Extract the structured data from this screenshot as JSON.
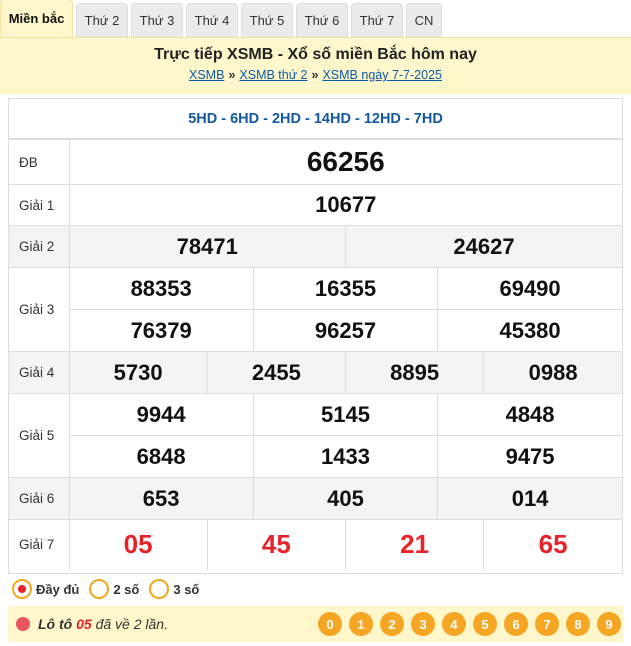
{
  "tabs": [
    "Miền bắc",
    "Thứ 2",
    "Thứ 3",
    "Thứ 4",
    "Thứ 5",
    "Thứ 6",
    "Thứ 7",
    "CN"
  ],
  "header": {
    "title": "Trực tiếp XSMB - Xổ số miền Bắc hôm nay",
    "breadcrumb": [
      "XSMB",
      "XSMB thứ 2",
      "XSMB ngày 7-7-2025"
    ],
    "separator": "»"
  },
  "codes": "5HD - 6HD - 2HD - 14HD - 12HD - 7HD",
  "prizes": {
    "db": {
      "label": "ĐB",
      "numbers": [
        "66256"
      ]
    },
    "g1": {
      "label": "Giải 1",
      "numbers": [
        "10677"
      ]
    },
    "g2": {
      "label": "Giải 2",
      "numbers": [
        "78471",
        "24627"
      ]
    },
    "g3": {
      "label": "Giải 3",
      "numbers": [
        "88353",
        "16355",
        "69490",
        "76379",
        "96257",
        "45380"
      ]
    },
    "g4": {
      "label": "Giải 4",
      "numbers": [
        "5730",
        "2455",
        "8895",
        "0988"
      ]
    },
    "g5": {
      "label": "Giải 5",
      "numbers": [
        "9944",
        "5145",
        "4848",
        "6848",
        "1433",
        "9475"
      ]
    },
    "g6": {
      "label": "Giải 6",
      "numbers": [
        "653",
        "405",
        "014"
      ]
    },
    "g7": {
      "label": "Giải 7",
      "numbers": [
        "05",
        "45",
        "21",
        "65"
      ]
    }
  },
  "display_options": {
    "selected": "Đầy đủ",
    "options": [
      "Đầy đủ",
      "2 số",
      "3 số"
    ]
  },
  "loto": {
    "prefix": "Lô tô",
    "number": "05",
    "suffix": "đã về 2 lần.",
    "digits": [
      "0",
      "1",
      "2",
      "3",
      "4",
      "5",
      "6",
      "7",
      "8",
      "9"
    ]
  },
  "colors": {
    "accent_red": "#e52329",
    "code_blue": "#1259a0",
    "header_bg": "#fff7cc",
    "digit_orange": "#f5a623"
  }
}
